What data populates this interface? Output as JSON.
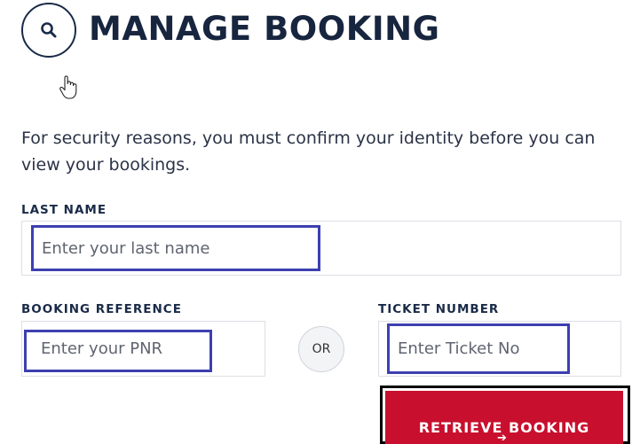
{
  "header": {
    "title": "MANAGE BOOKING",
    "icon": "search-icon"
  },
  "intro": {
    "text": "For security reasons, you must confirm your identity before you can view your bookings."
  },
  "form": {
    "last_name": {
      "label": "LAST NAME",
      "placeholder": "Enter your last name",
      "value": ""
    },
    "booking_reference": {
      "label": "BOOKING REFERENCE",
      "placeholder": "Enter your PNR",
      "value": ""
    },
    "or_label": "OR",
    "ticket_number": {
      "label": "TICKET NUMBER",
      "placeholder": "Enter Ticket No",
      "value": ""
    },
    "submit": {
      "label": "RETRIEVE BOOKING",
      "arrow": "➔"
    }
  },
  "colors": {
    "brand_navy": "#1a2b48",
    "accent_red": "#c8102e",
    "highlight_blue": "#3d3fb0"
  }
}
